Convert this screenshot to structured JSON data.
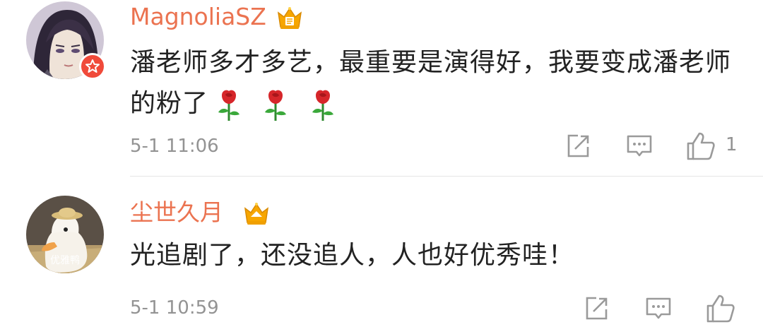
{
  "comments": [
    {
      "username": "MagnoliaSZ",
      "text": "潘老师多才多艺，最重要是演得好，我要变成潘老师的粉了",
      "emojis": [
        "rose-emoji",
        "rose-emoji",
        "rose-emoji"
      ],
      "time": "5-1 11:06",
      "like_count": "1",
      "actions": [
        "forward-icon",
        "reply-icon",
        "like-icon"
      ]
    },
    {
      "username": "尘世久月",
      "text": "光追剧了，还没追人，人也好优秀哇！",
      "avatar_watermark": "优雅鸭",
      "time": "5-1 10:59",
      "actions": [
        "forward-icon",
        "reply-icon",
        "like-icon"
      ]
    }
  ],
  "colors": {
    "username": "#eb7350",
    "text": "#222222",
    "meta": "#939393",
    "badge": "#f04a3a",
    "crown": "#f7a600"
  }
}
